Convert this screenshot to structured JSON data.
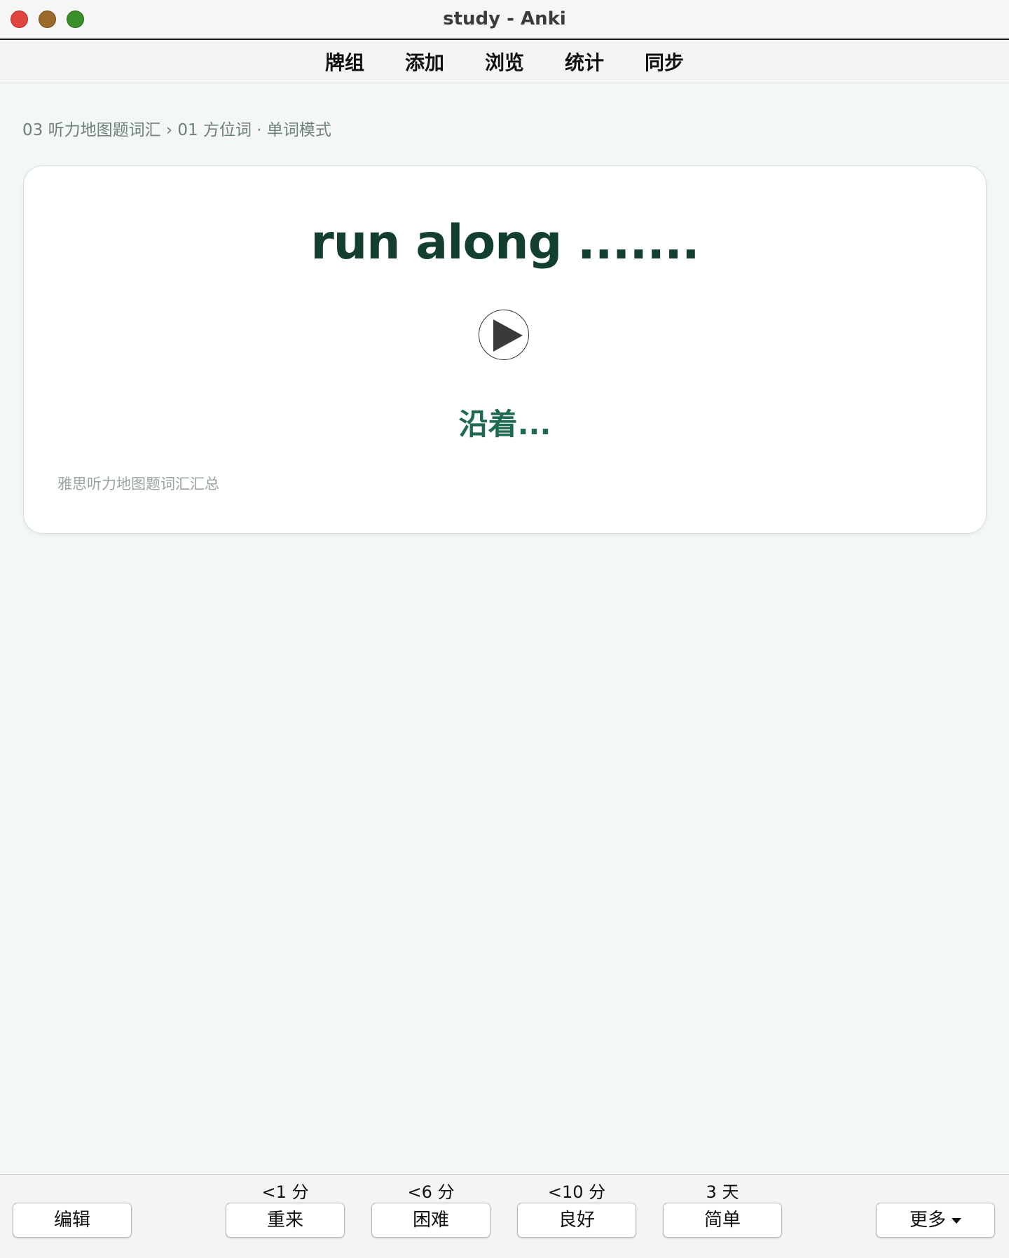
{
  "window": {
    "title": "study - Anki"
  },
  "topnav": {
    "items": [
      "牌组",
      "添加",
      "浏览",
      "统计",
      "同步"
    ]
  },
  "breadcrumb": "03 听力地图题词汇 › 01 方位词 · 单词模式",
  "card": {
    "word": "run along .......",
    "meaning": "沿着...",
    "source": "雅思听力地图题词汇汇总",
    "play_icon": "play-icon"
  },
  "bottombar": {
    "edit_label": "编辑",
    "more_label": "更多",
    "answers": [
      {
        "interval": "<1 分",
        "label": "重来"
      },
      {
        "interval": "<6 分",
        "label": "困难"
      },
      {
        "interval": "<10 分",
        "label": "良好"
      },
      {
        "interval": "3 天",
        "label": "简单"
      }
    ]
  },
  "colors": {
    "word": "#123f31",
    "meaning": "#1f6a4f",
    "background": "#f3f8f6",
    "close": "#e0443e",
    "minimize": "#9a6a2a",
    "maximize": "#3b8f2a"
  }
}
